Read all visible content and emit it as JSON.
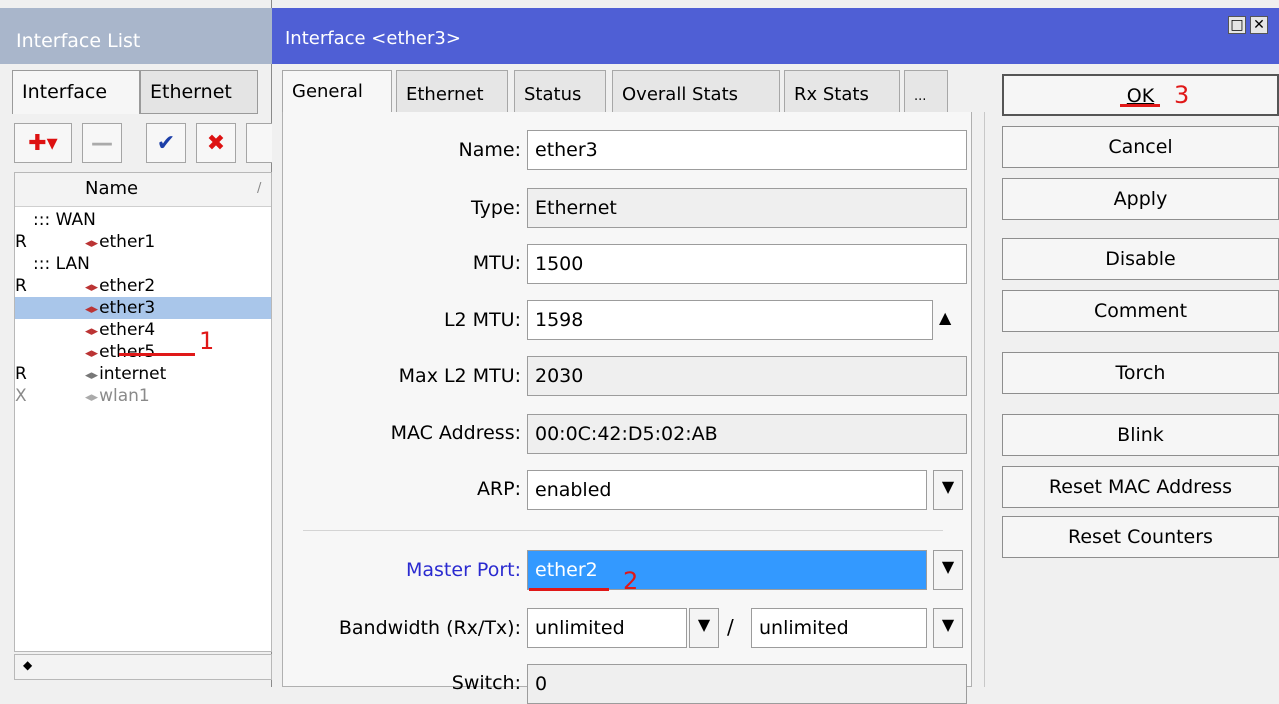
{
  "interface_list": {
    "title": "Interface List",
    "tabs": [
      "Interface",
      "Ethernet"
    ],
    "toolbar": {
      "add": "✚▾",
      "remove": "—",
      "enable": "✔",
      "disable": "✖"
    },
    "columns": {
      "name": "Name",
      "sort_marker": "/"
    },
    "rows": [
      {
        "flag": "",
        "name": "::: WAN",
        "group": true
      },
      {
        "flag": "R",
        "name": "ether1"
      },
      {
        "flag": "",
        "name": "::: LAN",
        "group": true
      },
      {
        "flag": "R",
        "name": "ether2"
      },
      {
        "flag": "",
        "name": "ether3",
        "selected": true
      },
      {
        "flag": "",
        "name": "ether4"
      },
      {
        "flag": "",
        "name": "ether5"
      },
      {
        "flag": "R",
        "name": "internet"
      },
      {
        "flag": "X",
        "name": "wlan1",
        "disabled": true
      }
    ],
    "scroll_left": "◆"
  },
  "dialog": {
    "title": "Interface <ether3>",
    "window_buttons": {
      "restore": "□",
      "close": "✕"
    },
    "tabs": [
      "General",
      "Ethernet",
      "Status",
      "Overall Stats",
      "Rx Stats",
      "..."
    ],
    "fields": {
      "name": {
        "label": "Name:",
        "value": "ether3"
      },
      "type": {
        "label": "Type:",
        "value": "Ethernet"
      },
      "mtu": {
        "label": "MTU:",
        "value": "1500"
      },
      "l2mtu": {
        "label": "L2 MTU:",
        "value": "1598",
        "toggle": "▲"
      },
      "max_l2mtu": {
        "label": "Max L2 MTU:",
        "value": "2030"
      },
      "mac": {
        "label": "MAC Address:",
        "value": "00:0C:42:D5:02:AB"
      },
      "arp": {
        "label": "ARP:",
        "value": "enabled"
      },
      "master_port": {
        "label": "Master Port:",
        "value": "ether2"
      },
      "bandwidth": {
        "label": "Bandwidth (Rx/Tx):",
        "rx": "unlimited",
        "tx": "unlimited",
        "separator": "/"
      },
      "switch": {
        "label": "Switch:",
        "value": "0"
      }
    },
    "dropdown_glyph": "▼",
    "buttons": {
      "ok": "OK",
      "cancel": "Cancel",
      "apply": "Apply",
      "disable": "Disable",
      "comment": "Comment",
      "torch": "Torch",
      "blink": "Blink",
      "reset_mac": "Reset MAC Address",
      "reset_counters": "Reset Counters"
    }
  },
  "annotations": {
    "step1": "1",
    "step2": "2",
    "step3": "3"
  },
  "colors": {
    "title_active": "#4f5fd5",
    "title_inactive": "#a9b6cb",
    "selection": "#3399ff",
    "annotation": "#e01818",
    "master_port_label": "#2a2ad0"
  }
}
